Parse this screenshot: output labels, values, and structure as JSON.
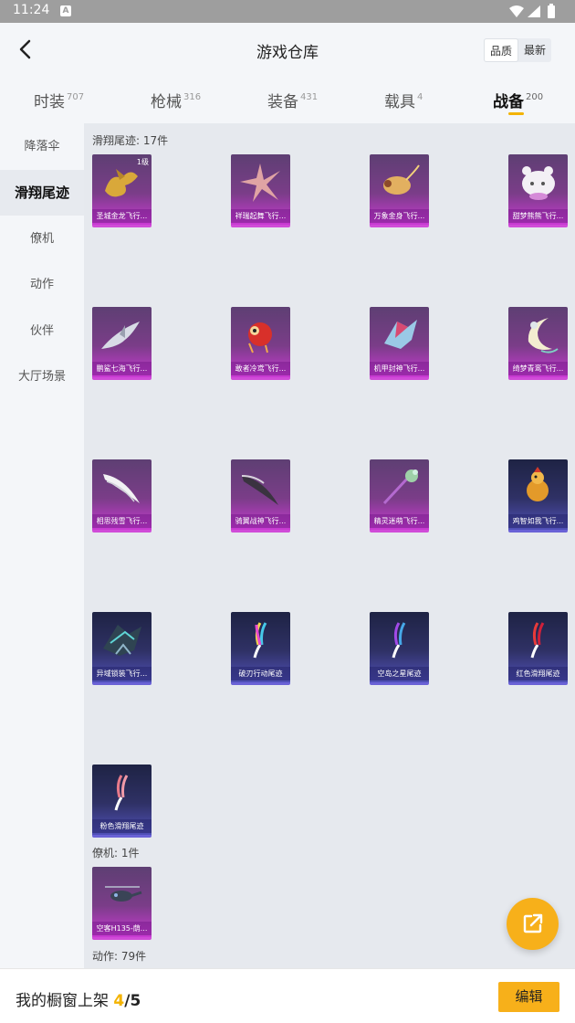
{
  "status_bar": {
    "time": "11:24",
    "app_icon": "A"
  },
  "header": {
    "title": "游戏仓库",
    "sort_options": [
      "品质",
      "最新"
    ],
    "sort_selected": "品质"
  },
  "tabs": [
    {
      "label": "时装",
      "count": "707"
    },
    {
      "label": "枪械",
      "count": "316"
    },
    {
      "label": "装备",
      "count": "431"
    },
    {
      "label": "载具",
      "count": "4"
    },
    {
      "label": "战备",
      "count": "200",
      "active": true
    }
  ],
  "sidebar": {
    "items": [
      {
        "label": "降落伞"
      },
      {
        "label": "滑翔尾迹",
        "active": true
      },
      {
        "label": "僚机"
      },
      {
        "label": "动作"
      },
      {
        "label": "伙伴"
      },
      {
        "label": "大厅场景"
      }
    ]
  },
  "sections": {
    "glide": {
      "title": "滑翔尾迹: 17件",
      "items": [
        {
          "name": "圣城金龙飞行...",
          "level": "1级",
          "rarity": "purple",
          "art": "dragon"
        },
        {
          "name": "祥瑞起舞飞行...",
          "rarity": "purple",
          "art": "star"
        },
        {
          "name": "万象金身飞行...",
          "rarity": "purple",
          "art": "beast"
        },
        {
          "name": "甜梦熊熊飞行...",
          "rarity": "purple",
          "art": "bear"
        },
        {
          "name": "鹏鲨七海飞行...",
          "rarity": "purple",
          "art": "shark"
        },
        {
          "name": "敢者冷鸢飞行...",
          "rarity": "purple",
          "art": "bird"
        },
        {
          "name": "机甲封神飞行...",
          "rarity": "purple",
          "art": "mech"
        },
        {
          "name": "绮梦青鸾飞行...",
          "rarity": "purple",
          "art": "moon"
        },
        {
          "name": "相思残雪飞行...",
          "rarity": "purple",
          "art": "wing"
        },
        {
          "name": "骑翼战神飞行...",
          "rarity": "purple",
          "art": "wingdark"
        },
        {
          "name": "精灵迷萌飞行...",
          "rarity": "purple",
          "art": "wand"
        },
        {
          "name": "鸡智如我飞行...",
          "rarity": "blue",
          "art": "chicken"
        },
        {
          "name": "异域锁装飞行...",
          "rarity": "blue",
          "art": "mech2"
        },
        {
          "name": "破刃行动尾迹",
          "rarity": "blue",
          "art": "trail-rainbow"
        },
        {
          "name": "空岛之星尾迹",
          "rarity": "blue",
          "art": "trail-blue"
        },
        {
          "name": "红色滑翔尾迹",
          "rarity": "blue",
          "art": "trail-red"
        },
        {
          "name": "粉色滑翔尾迹",
          "rarity": "blue",
          "art": "trail-pink"
        }
      ]
    },
    "wingman": {
      "title": "僚机: 1件",
      "items": [
        {
          "name": "空客H135-荫...",
          "rarity": "purple",
          "art": "heli"
        }
      ]
    },
    "actions": {
      "title": "动作: 79件"
    }
  },
  "bottom_bar": {
    "label": "我的橱窗上架 ",
    "count": "4",
    "total": "/5",
    "edit_label": "编辑"
  },
  "colors": {
    "accent": "#f7b01a",
    "purple_rarity": "#c93ad3",
    "blue_rarity": "#5050b8"
  }
}
